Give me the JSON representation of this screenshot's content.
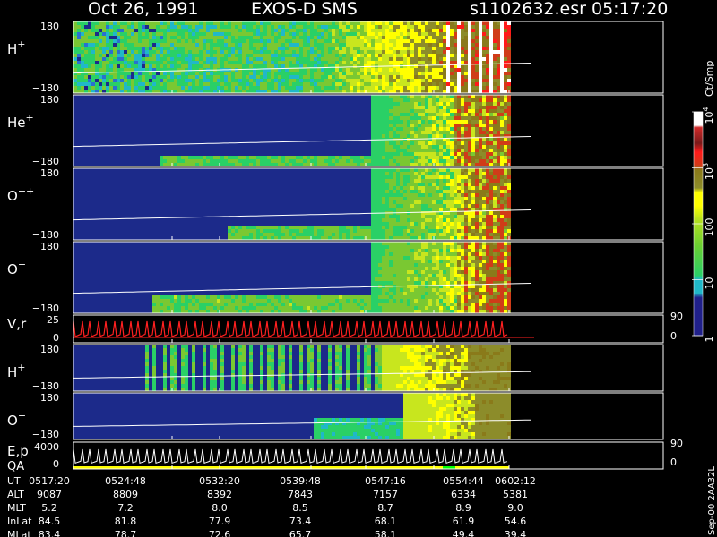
{
  "header": {
    "date": "Oct 26, 1991",
    "instrument": "EXOS-D SMS",
    "file": "s1102632.esr",
    "time": "05:17:20"
  },
  "colors": {
    "background": "#000000",
    "frame": "#ffffff",
    "trace": "#ffffff",
    "vr_trace": "#ff2020",
    "qa_fill": "#ffff00",
    "qa_mark": "#00ff00",
    "scale_stops": [
      "#20208a",
      "#2a70d0",
      "#20b8c8",
      "#2ad066",
      "#7ac832",
      "#c8e61e",
      "#ffff00",
      "#8c8c2a",
      "#8a7a1a",
      "#d03c18",
      "#ff1a1a",
      "#ffffff"
    ]
  },
  "colorbar": {
    "unit": "Ct/Smp",
    "ticks": [
      {
        "label": "1",
        "level": 0
      },
      {
        "label": "10",
        "level": 1
      },
      {
        "label": "100",
        "level": 2
      },
      {
        "label": "10",
        "sup": "3",
        "level": 3
      },
      {
        "label": "10",
        "sup": "4",
        "level": 4
      }
    ]
  },
  "footer_note": "Sep-00 2AA32L",
  "ephemeris": {
    "rows": [
      {
        "label": "UT",
        "values": [
          "0517:20",
          "0524:48",
          "0532:20",
          "0539:48",
          "0547:16",
          "0554:44",
          "0602:12"
        ]
      },
      {
        "label": "ALT",
        "values": [
          "9087",
          "8809",
          "8392",
          "7843",
          "7157",
          "6334",
          "5381"
        ]
      },
      {
        "label": "MLT",
        "values": [
          "5.2",
          "7.2",
          "8.0",
          "8.5",
          "8.7",
          "8.9",
          "9.0"
        ]
      },
      {
        "label": "InLat",
        "values": [
          "84.5",
          "81.8",
          "77.9",
          "73.4",
          "68.1",
          "61.9",
          "54.6"
        ]
      },
      {
        "label": "MLat",
        "values": [
          "83.4",
          "78.7",
          "72.6",
          "65.7",
          "58.1",
          "49.4",
          "39.4"
        ]
      }
    ]
  },
  "chart_data": {
    "type": "heatmap",
    "x": [
      "0517:20",
      "0524:48",
      "0532:20",
      "0539:48",
      "0547:16",
      "0554:44",
      "0602:12"
    ],
    "panels": [
      {
        "id": "h-plus",
        "name": "H",
        "sup": "+",
        "kind": "spectrogram",
        "yticks": [
          "180",
          "−180"
        ]
      },
      {
        "id": "he-plus",
        "name": "He",
        "sup": "+",
        "kind": "spectrogram",
        "yticks": [
          "180",
          "−180"
        ]
      },
      {
        "id": "o-pp",
        "name": "O",
        "sup": "++",
        "kind": "spectrogram",
        "yticks": [
          "180",
          "−180"
        ]
      },
      {
        "id": "o-plus",
        "name": "O",
        "sup": "+",
        "kind": "spectrogram",
        "yticks": [
          "180",
          "−180"
        ]
      },
      {
        "id": "vr",
        "name": "V,r",
        "sup": "",
        "kind": "line",
        "yticks": [
          "25",
          "0"
        ],
        "right_ticks": [
          "90",
          "0"
        ]
      },
      {
        "id": "h-plus-2",
        "name": "H",
        "sup": "+",
        "kind": "spectrogram",
        "yticks": [
          "180",
          "−180"
        ]
      },
      {
        "id": "o-plus-2",
        "name": "O",
        "sup": "+",
        "kind": "spectrogram",
        "yticks": [
          "180",
          "−180"
        ]
      },
      {
        "id": "ep",
        "name": "E,p",
        "sub": "QA",
        "kind": "line",
        "yticks": [
          "4000",
          "0"
        ],
        "right_ticks": [
          "90",
          "0"
        ]
      }
    ],
    "color_scale": {
      "unit": "Ct/Smp",
      "log": true,
      "range": [
        1,
        10000
      ]
    }
  }
}
